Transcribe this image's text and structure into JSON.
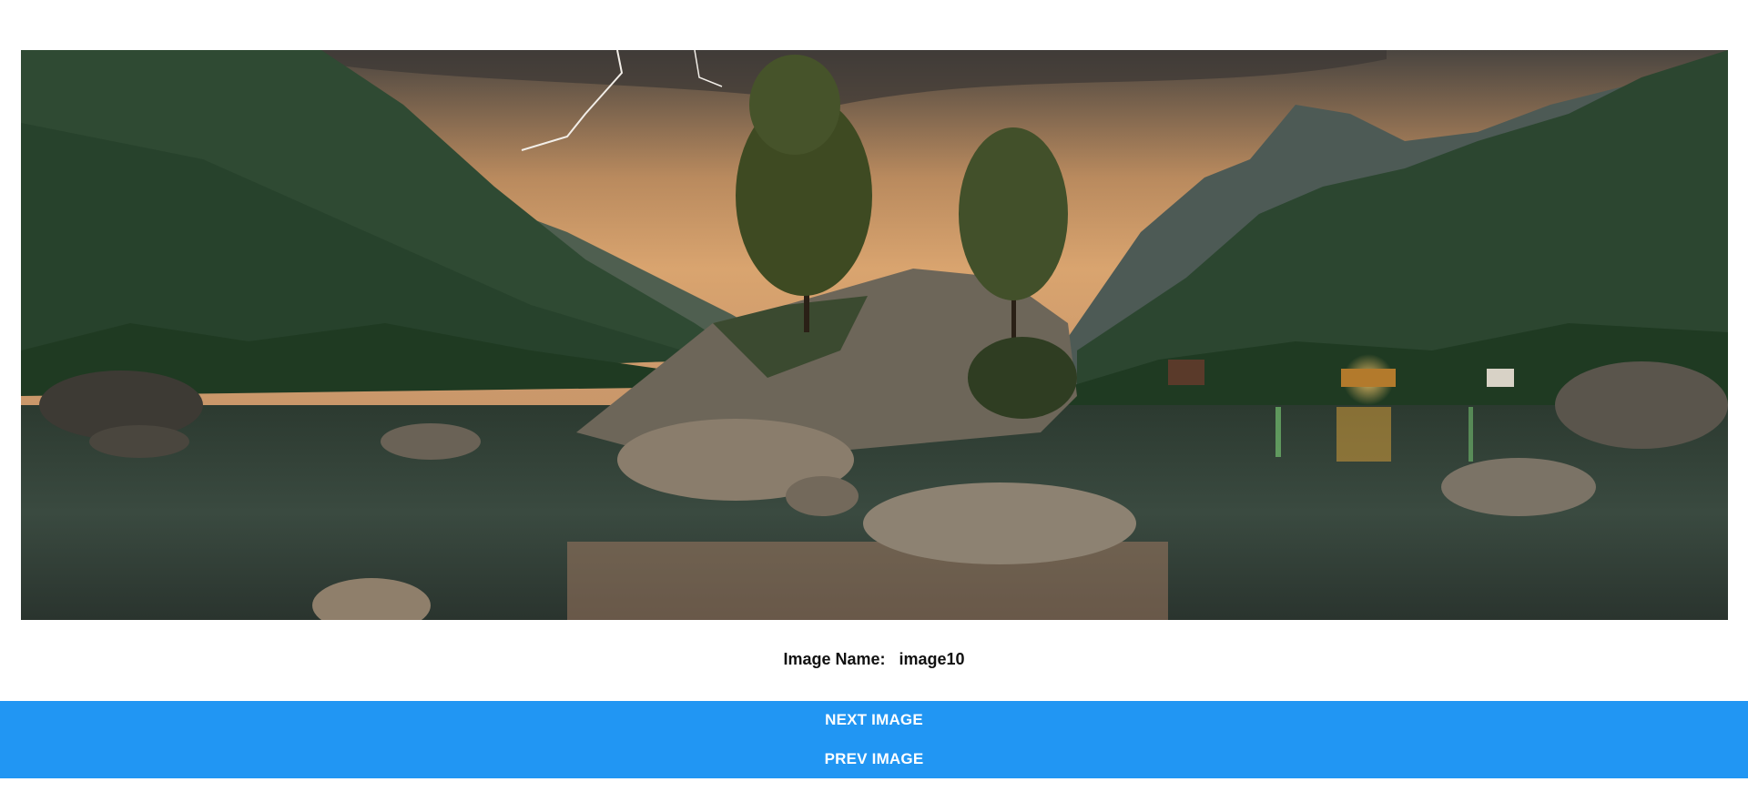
{
  "viewer": {
    "image_alt": "image10",
    "caption_label": "Image Name:",
    "caption_value": "image10"
  },
  "buttons": {
    "next_label": "NEXT IMAGE",
    "prev_label": "PREV IMAGE"
  },
  "colors": {
    "button_bg": "#2196f3",
    "button_text": "#ffffff",
    "page_bg": "#ffffff"
  }
}
